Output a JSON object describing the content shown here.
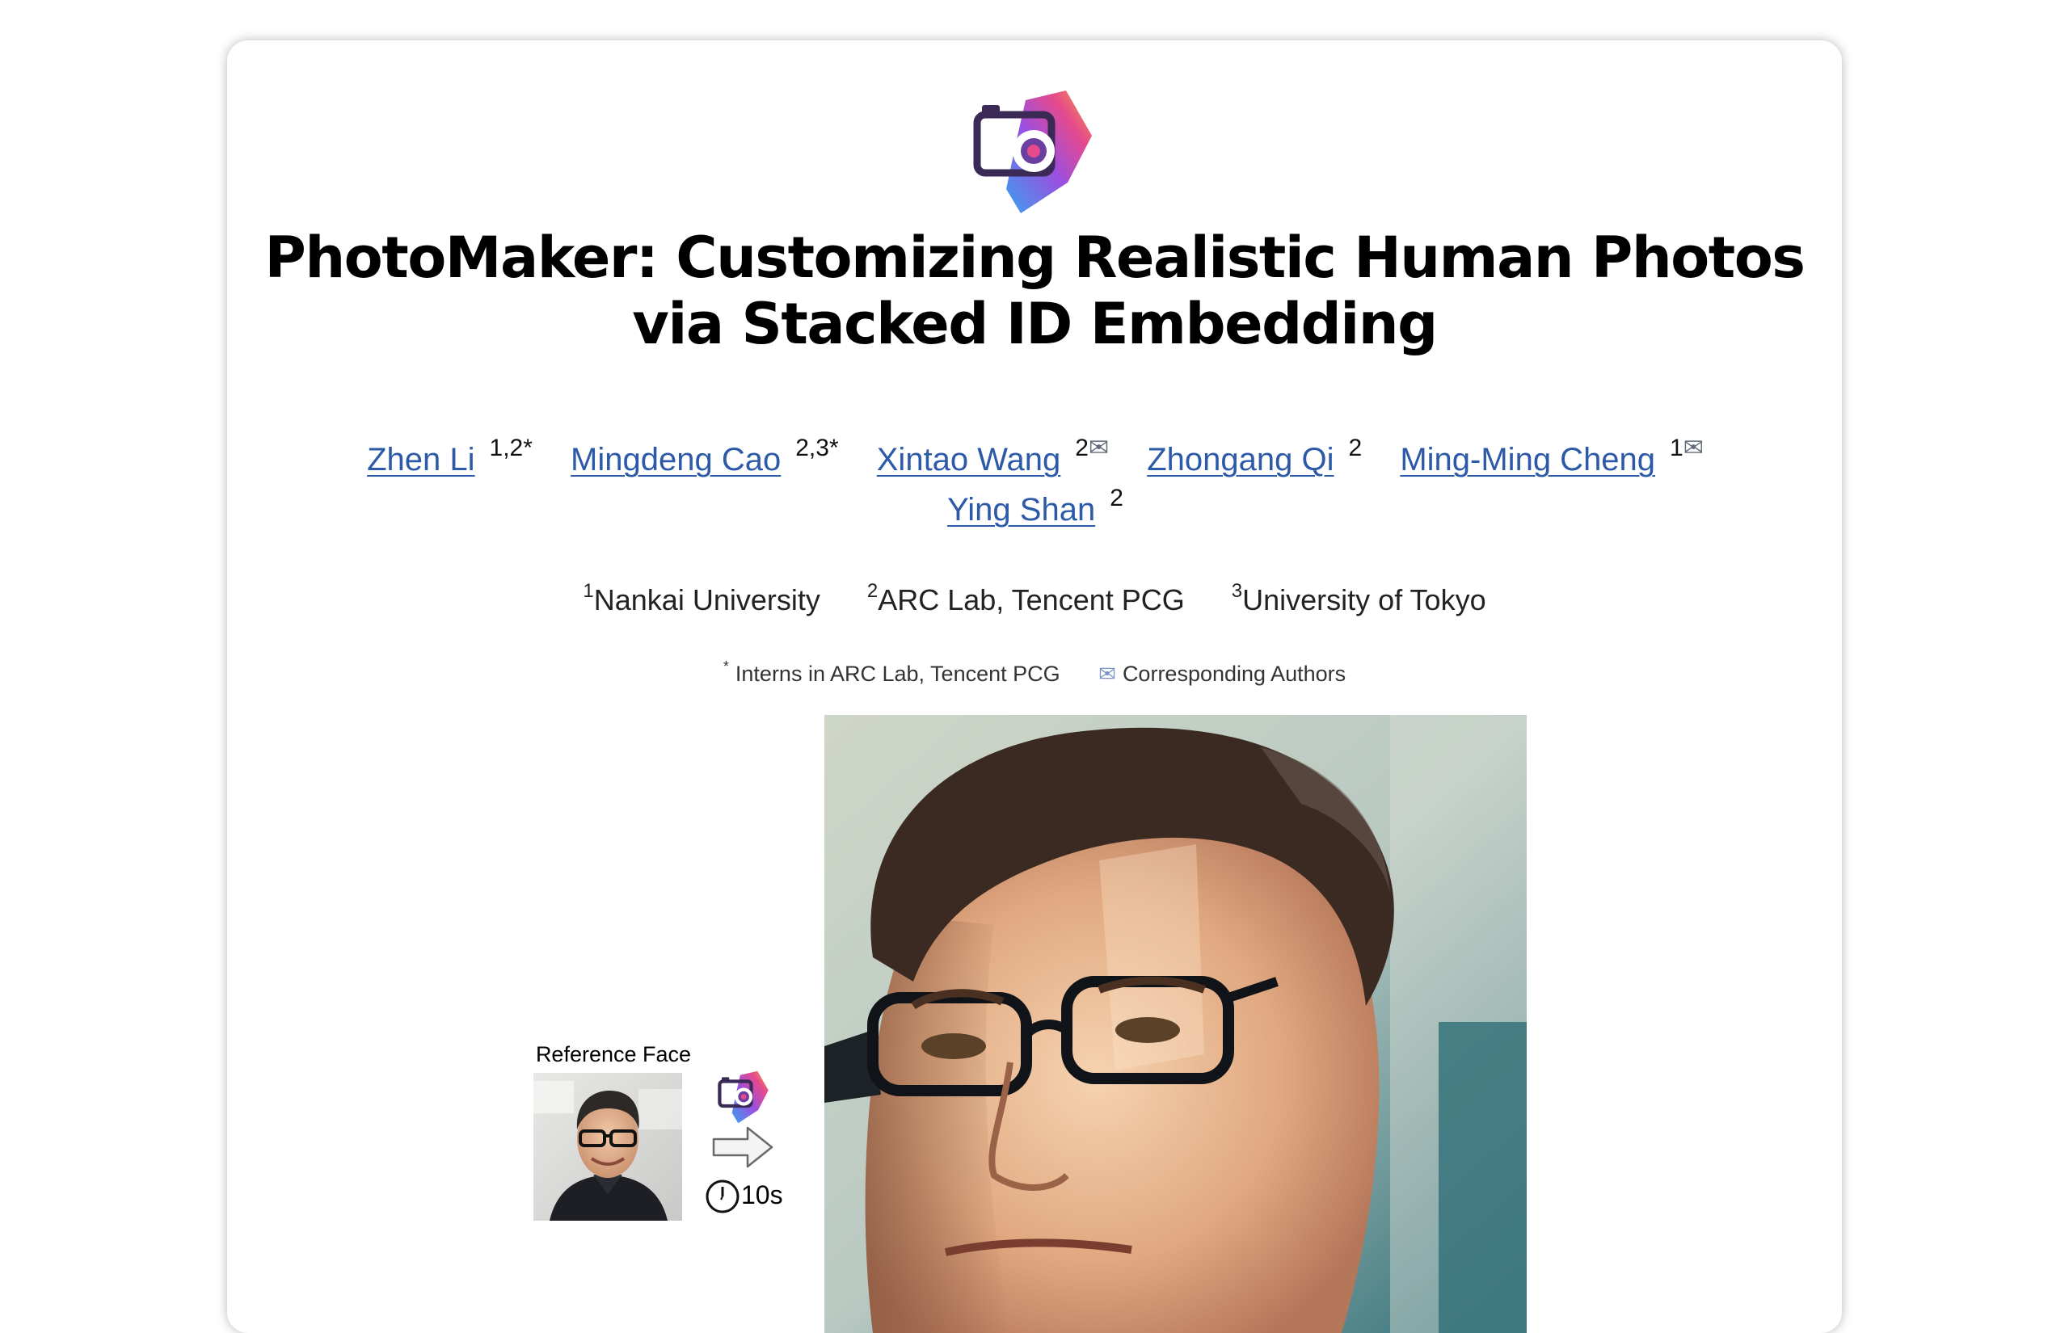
{
  "page": {
    "title_line1": "PhotoMaker: Customizing Realistic Human Photos",
    "title_line2": "via Stacked ID Embedding"
  },
  "authors": [
    {
      "name": "Zhen Li",
      "affil": "1,2*"
    },
    {
      "name": "Mingdeng Cao",
      "affil": "2,3*"
    },
    {
      "name": "Xintao Wang",
      "affil": "2"
    },
    {
      "name": "Zhongang Qi",
      "affil": "2"
    },
    {
      "name": "Ming-Ming Cheng",
      "affil": "1"
    },
    {
      "name": "Ying Shan",
      "affil": "2"
    }
  ],
  "corresponding_icon": "envelope-icon",
  "affiliations": [
    {
      "num": "1",
      "name": "Nankai University"
    },
    {
      "num": "2",
      "name": "ARC Lab, Tencent PCG"
    },
    {
      "num": "3",
      "name": "University of Tokyo"
    }
  ],
  "notes": {
    "intern_mark": "*",
    "intern_text": "Interns in ARC Lab, Tencent PCG",
    "corresponding_text": "Corresponding Authors"
  },
  "demo": {
    "reference_label": "Reference Face",
    "time_label": "10s"
  },
  "colors": {
    "link": "#2d5aa8",
    "logo_gradient": [
      "#f1a33c",
      "#e64a8c",
      "#9b4fe0",
      "#3aa0f0"
    ],
    "camera": "#3a2a55"
  }
}
